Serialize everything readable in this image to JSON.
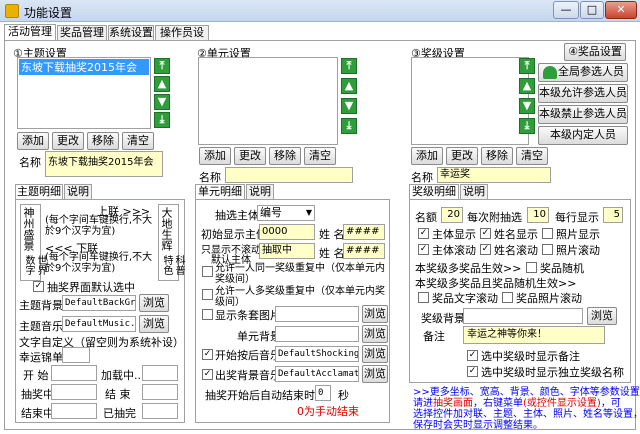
{
  "window": {
    "title": "功能设置",
    "min": "—",
    "max": "□",
    "close": "✕"
  },
  "tabs": [
    "活动管理",
    "奖品管理",
    "系统设置",
    "操作员设置"
  ],
  "section1": {
    "title": "①主题设置",
    "list_item": "东坡下载抽奖2015年会",
    "buttons": [
      "添加",
      "更改",
      "移除",
      "清空"
    ],
    "name_label": "名称",
    "name_value": "东坡下载抽奖2015年会",
    "subtabs": [
      "主题明细",
      "说明"
    ],
    "vert_left": "神州盛景",
    "vert_left2": "世界数字",
    "vert_right": "大地生辉",
    "vert_right2": "科普特色",
    "scroll_up": "上联 >>>",
    "scroll_up_note": "(每个字间车键换行,不大於9个汉字为宜)",
    "scroll_down": "<<< 下联",
    "scroll_down_note": "(每个字间车键换行,不大於9个汉字为宜)",
    "default_check": "抽奖界面默认选中",
    "bg_label": "主题背景",
    "bg_value": "DefaultBackGrou",
    "music_label": "主题音乐",
    "music_value": "DefaultMusic.mp3",
    "browse": "浏览",
    "custom_text": "文字自定义（留空则为系统补设）",
    "welcome": "幸运锦单",
    "start": "开 始",
    "loading": "加载中...",
    "drawing": "抽奖中",
    "end": "结 束",
    "ended": "结束中",
    "drawn": "已抽完"
  },
  "section2": {
    "title": "②单元设置",
    "buttons": [
      "添加",
      "更改",
      "移除",
      "清空"
    ],
    "name_label": "名称",
    "subtabs": [
      "单元明细",
      "说明"
    ],
    "draw_subject": "抽选主体",
    "draw_subject_value": "编号",
    "init_label": "初始显示主体",
    "init_value": "0000",
    "init_name_label": "姓 名",
    "init_name_value": "####",
    "scroll_label": "只显示不滚动",
    "scroll_label2": "默认主体",
    "scroll_value": "抽取中",
    "scroll_name_label": "姓 名",
    "scroll_name_value": "####",
    "allow_same": "允许一人同一奖级重复中（仅本单元内奖级间）",
    "allow_multi": "允许一人多奖级重复中（仅本单元内奖级间）",
    "show_bg_img": "显示条套图片",
    "unit_bg": "单元背景",
    "start_music": "开始按后音乐",
    "start_music_value": "DefaultShocking.m",
    "exit_music": "出奖背景音乐",
    "exit_music_value": "DefaultAcclamation",
    "auto_end_label": "抽奖开始后自动结束时间",
    "auto_end_value": "0",
    "auto_end_unit": "秒",
    "manual_note": "0为手动结束",
    "browse": "浏览"
  },
  "section3": {
    "title": "③奖级设置",
    "prize_btn": "④奖品设置",
    "side_buttons": [
      "全局参选人员",
      "本级允许参选人员",
      "本级禁止参选人员",
      "本级内定人员"
    ],
    "buttons": [
      "添加",
      "更改",
      "移除",
      "清空"
    ],
    "name_label": "名称",
    "name_value": "幸运奖",
    "subtabs": [
      "奖级明细",
      "说明"
    ],
    "count_label": "名额",
    "count_value": "20",
    "each_label": "每次附抽选",
    "each_value": "10",
    "row_label": "每行显示",
    "row_value": "5",
    "subject_show": "主体显示",
    "name_show": "姓名显示",
    "photo_show": "照片显示",
    "subject_scroll": "主体滚动",
    "name_scroll": "姓名滚动",
    "photo_scroll": "照片滚动",
    "prize_valid": "本奖级多奖品生效>>",
    "prize_random": "奖品随机",
    "prize_multi": "本奖级多奖品且奖品随机生效>>",
    "prize_text_scroll": "奖品文字滚动",
    "prize_photo_scroll": "奖品照片滚动",
    "prize_bg": "奖级背景",
    "remark_label": "备注",
    "remark_value": "幸运之神等你来！",
    "show_remark": "选中奖级时显示备注",
    "show_name": "选中奖级时显示独立奖级名称",
    "browse": "浏览"
  },
  "footer_note": {
    "line1": ">>更多坐标、宽高、背景、颜色、字体等参数设置",
    "line2a": "请进",
    "line2b": "抽奖画面",
    "line2c": "，右键菜单",
    "line2d": "(或控件显示设置)",
    "line2e": "，可",
    "line3": "选择控件加对联、主题、主体、照片、姓名等设置，",
    "line4": "保存时会实时显示调整结果。"
  },
  "colors": {
    "accent": "#2e9d3a",
    "highlight": "#3399ff",
    "note_blue": "#0000ff",
    "note_red": "#e00000",
    "field_yellow": "#ffffc8"
  }
}
